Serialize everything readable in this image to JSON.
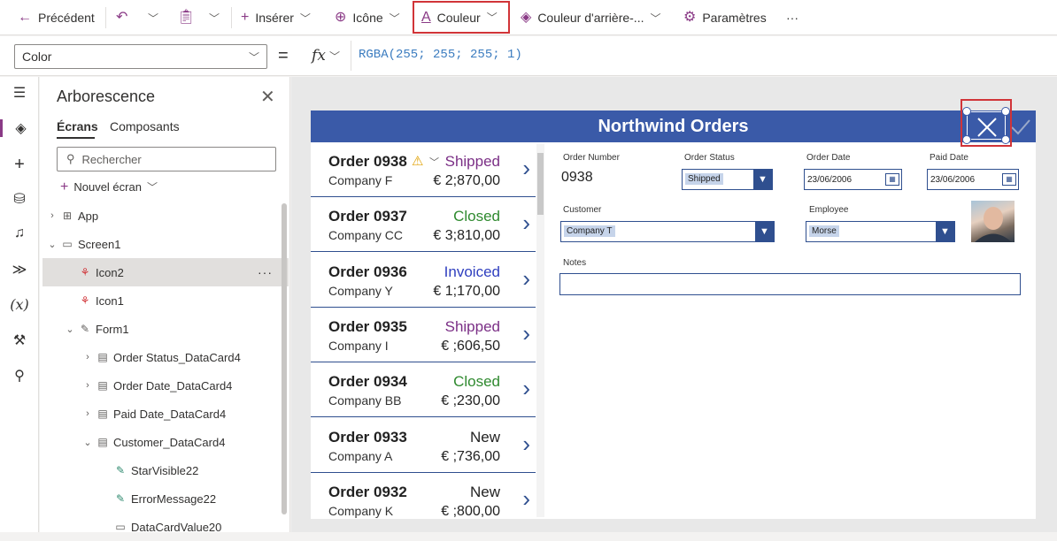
{
  "toolbar": {
    "back": "Précédent",
    "insert": "Insérer",
    "icon": "Icône",
    "color": "Couleur",
    "bgcolor": "Couleur d'arrière-...",
    "settings": "Paramètres",
    "more": "···"
  },
  "formula_bar": {
    "property": "Color",
    "equals": "=",
    "fx": "fx",
    "formula": "RGBA(255; 255; 255; 1)"
  },
  "tree": {
    "title": "Arborescence",
    "tabs": [
      "Écrans",
      "Composants"
    ],
    "search_placeholder": "Rechercher",
    "new_screen": "Nouvel écran",
    "items": [
      {
        "label": "App"
      },
      {
        "label": "Screen1"
      },
      {
        "label": "Icon2"
      },
      {
        "label": "Icon1"
      },
      {
        "label": "Form1"
      },
      {
        "label": "Order Status_DataCard4"
      },
      {
        "label": "Order Date_DataCard4"
      },
      {
        "label": "Paid Date_DataCard4"
      },
      {
        "label": "Customer_DataCard4"
      },
      {
        "label": "StarVisible22"
      },
      {
        "label": "ErrorMessage22"
      },
      {
        "label": "DataCardValue20"
      }
    ],
    "more": "···"
  },
  "app": {
    "title": "Northwind Orders",
    "orders": [
      {
        "order": "Order 0938",
        "company": "Company F",
        "status": "Shipped",
        "amount": "€ 2;870,00",
        "status_color": "#7b2f86"
      },
      {
        "order": "Order 0937",
        "company": "Company CC",
        "status": "Closed",
        "amount": "€ 3;810,00",
        "status_color": "#2f8a2f"
      },
      {
        "order": "Order 0936",
        "company": "Company Y",
        "status": "Invoiced",
        "amount": "€ 1;170,00",
        "status_color": "#2f3fbf"
      },
      {
        "order": "Order 0935",
        "company": "Company I",
        "status": "Shipped",
        "amount": "€ ;606,50",
        "status_color": "#7b2f86"
      },
      {
        "order": "Order 0934",
        "company": "Company BB",
        "status": "Closed",
        "amount": "€ ;230,00",
        "status_color": "#2f8a2f"
      },
      {
        "order": "Order 0933",
        "company": "Company A",
        "status": "New",
        "amount": "€ ;736,00",
        "status_color": "#222222"
      },
      {
        "order": "Order 0932",
        "company": "Company K",
        "status": "New",
        "amount": "€ ;800,00",
        "status_color": "#222222"
      }
    ],
    "form": {
      "order_number_label": "Order Number",
      "order_number": "0938",
      "order_status_label": "Order Status",
      "order_status": "Shipped",
      "order_date_label": "Order Date",
      "order_date": "23/06/2006",
      "paid_date_label": "Paid Date",
      "paid_date": "23/06/2006",
      "customer_label": "Customer",
      "customer": "Company T",
      "employee_label": "Employee",
      "employee": "Morse",
      "notes_label": "Notes"
    }
  }
}
